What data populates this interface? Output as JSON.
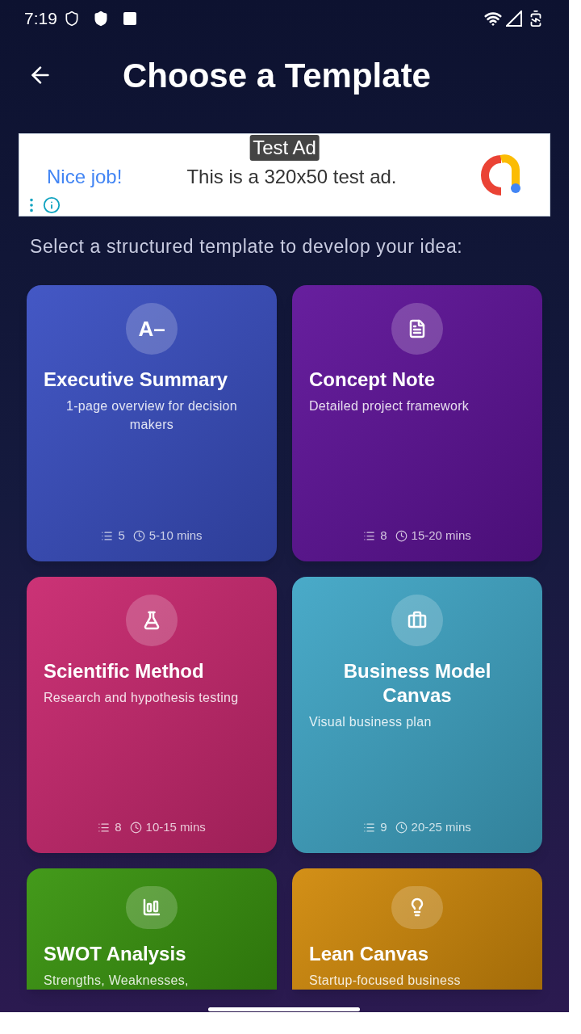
{
  "status_bar": {
    "time": "7:19"
  },
  "header": {
    "title": "Choose a Template"
  },
  "ad": {
    "badge": "Test Ad",
    "headline": "Nice job!",
    "body": "This is a 320x50 test ad."
  },
  "subtitle": "Select a structured template to develop your idea:",
  "templates": [
    {
      "title": "Executive Summary",
      "description": "1-page overview for decision makers",
      "sections": "5",
      "duration": "5-10 mins",
      "color": "#3a4fc2",
      "icon": {
        "kind": "glyph",
        "text": "A–"
      }
    },
    {
      "title": "Concept Note",
      "description": "Detailed project framework",
      "sections": "8",
      "duration": "15-20 mins",
      "color": "#5f1399",
      "icon": {
        "kind": "document"
      }
    },
    {
      "title": "Scientific Method",
      "description": "Research and hypothesis testing",
      "sections": "8",
      "duration": "10-15 mins",
      "color": "#c9286f",
      "icon": {
        "kind": "flask"
      }
    },
    {
      "title": "Business Model Canvas",
      "description": "Visual business plan",
      "sections": "9",
      "duration": "20-25 mins",
      "color": "#40a6c6",
      "icon": {
        "kind": "briefcase"
      }
    },
    {
      "title": "SWOT Analysis",
      "description": "Strengths, Weaknesses,",
      "color": "#3a950f",
      "icon": {
        "kind": "chart"
      }
    },
    {
      "title": "Lean Canvas",
      "description": "Startup-focused business",
      "color": "#d18a0b",
      "icon": {
        "kind": "bulb"
      }
    }
  ]
}
